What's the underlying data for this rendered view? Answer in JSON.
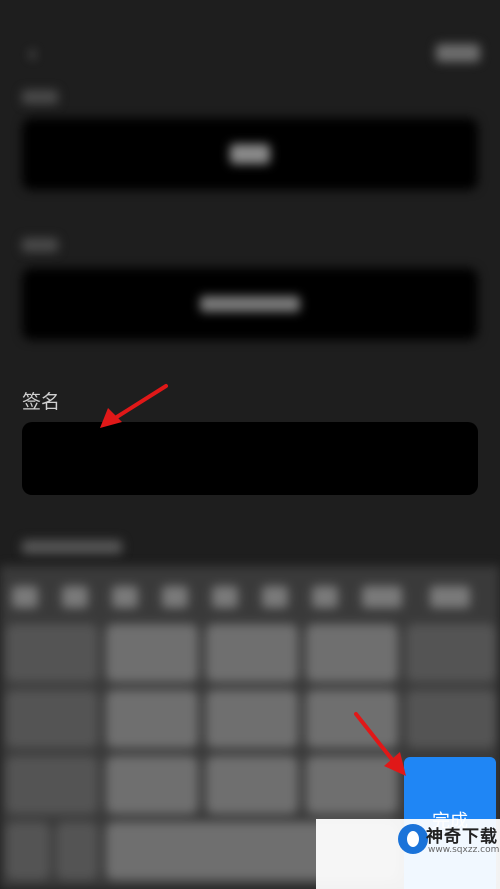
{
  "signature": {
    "label": "签名",
    "value": ""
  },
  "keyboard": {
    "done_label": "完成"
  },
  "watermark": {
    "name": "神奇下载",
    "url": "www.sqxzz.com"
  },
  "colors": {
    "accent": "#1f86f5",
    "arrow": "#e01818",
    "background": "#1e1e1e",
    "field": "#000000"
  }
}
